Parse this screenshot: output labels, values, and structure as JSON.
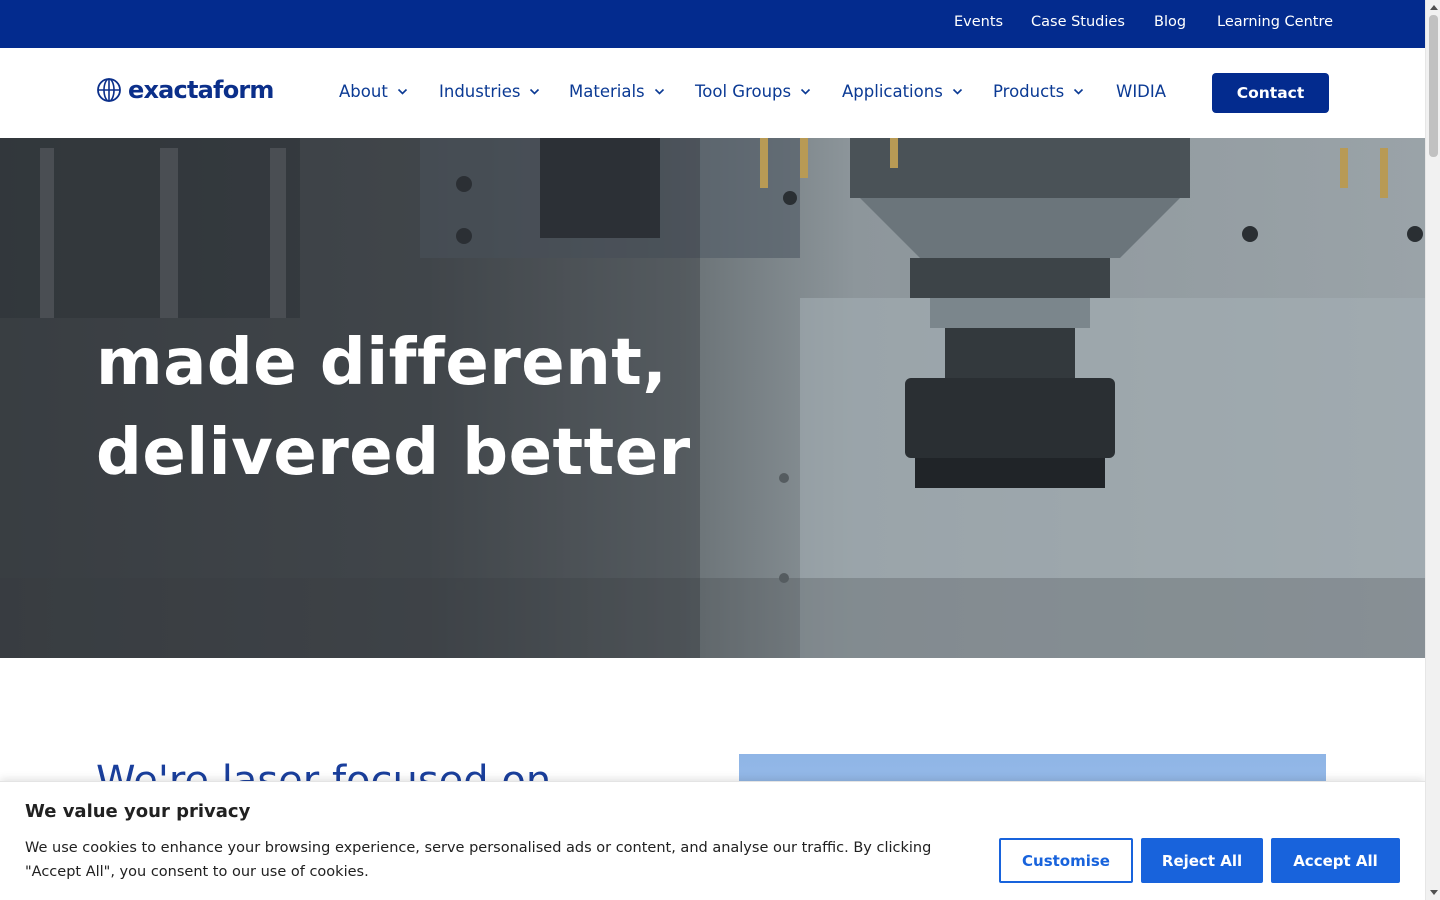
{
  "topbar": {
    "links": [
      "Events",
      "Case Studies",
      "Blog",
      "Learning Centre"
    ]
  },
  "header": {
    "logo_text": "exactaform",
    "nav": [
      "About",
      "Industries",
      "Materials",
      "Tool Groups",
      "Applications",
      "Products",
      "WIDIA"
    ],
    "contact_label": "Contact"
  },
  "hero": {
    "line1": "made different,",
    "line2": "delivered better"
  },
  "section": {
    "heading": "We're laser focused on"
  },
  "cookie": {
    "title": "We value your privacy",
    "text": "We use cookies to enhance your browsing experience, serve personalised ads or content, and analyse our traffic. By clicking \"Accept All\", you consent to our use of cookies.",
    "customise": "Customise",
    "reject": "Reject All",
    "accept": "Accept All"
  },
  "colors": {
    "brand_navy": "#032b8e",
    "cookie_blue": "#1863dc"
  }
}
